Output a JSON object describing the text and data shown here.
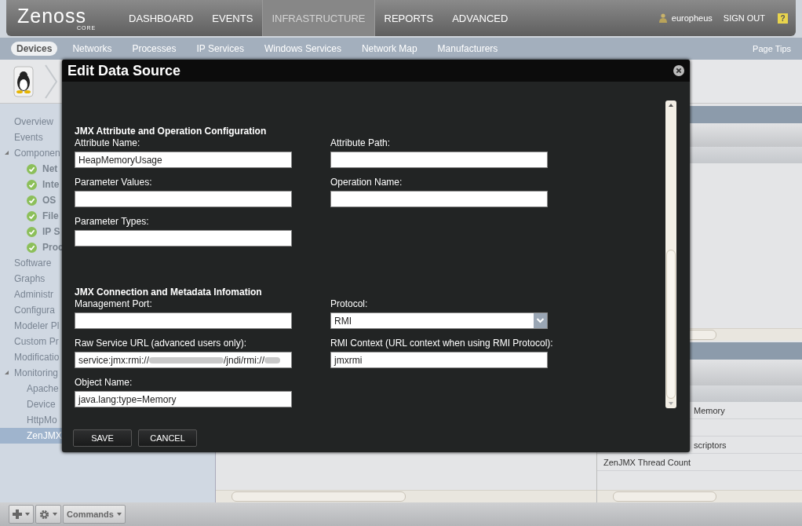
{
  "top_nav": {
    "logo": "Zenoss",
    "logo_sub": "CORE",
    "items": [
      {
        "label": "DASHBOARD",
        "selected": false
      },
      {
        "label": "EVENTS",
        "selected": false
      },
      {
        "label": "INFRASTRUCTURE",
        "selected": true
      },
      {
        "label": "REPORTS",
        "selected": false
      },
      {
        "label": "ADVANCED",
        "selected": false
      }
    ],
    "user": "europheus",
    "sign_out": "SIGN OUT",
    "help": "?"
  },
  "sub_nav": {
    "items": [
      {
        "label": "Devices",
        "selected": true
      },
      {
        "label": "Networks",
        "selected": false
      },
      {
        "label": "Processes",
        "selected": false
      },
      {
        "label": "IP Services",
        "selected": false
      },
      {
        "label": "Windows Services",
        "selected": false
      },
      {
        "label": "Network Map",
        "selected": false
      },
      {
        "label": "Manufacturers",
        "selected": false
      }
    ],
    "page_tips": "Page Tips"
  },
  "sidebar": {
    "items": [
      {
        "label": "Overview",
        "kind": "link",
        "selected": false
      },
      {
        "label": "Events",
        "kind": "link",
        "selected": false
      },
      {
        "label": "Componen",
        "kind": "group",
        "expanded": true,
        "selected": false,
        "children": [
          {
            "label": "Net",
            "kind": "status",
            "selected": false
          },
          {
            "label": "Inte",
            "kind": "status",
            "selected": false
          },
          {
            "label": "OS",
            "kind": "status",
            "selected": false
          },
          {
            "label": "File",
            "kind": "status",
            "selected": false
          },
          {
            "label": "IP S",
            "kind": "status",
            "selected": false
          },
          {
            "label": "Proc",
            "kind": "status",
            "selected": false
          }
        ]
      },
      {
        "label": "Software",
        "kind": "link",
        "selected": false
      },
      {
        "label": "Graphs",
        "kind": "link",
        "selected": false
      },
      {
        "label": "Administr",
        "kind": "link",
        "selected": false
      },
      {
        "label": "Configura",
        "kind": "link",
        "selected": false
      },
      {
        "label": "Modeler Pl",
        "kind": "link",
        "selected": false
      },
      {
        "label": "Custom Pr",
        "kind": "link",
        "selected": false
      },
      {
        "label": "Modificatio",
        "kind": "link",
        "selected": false
      },
      {
        "label": "Monitoring",
        "kind": "group",
        "expanded": true,
        "selected": false,
        "children": [
          {
            "label": "Apache",
            "kind": "link",
            "selected": false
          },
          {
            "label": "Device",
            "kind": "link",
            "selected": false
          },
          {
            "label": "HttpMo",
            "kind": "link",
            "selected": false
          },
          {
            "label": "ZenJMX",
            "kind": "link",
            "selected": true
          }
        ]
      }
    ]
  },
  "graph_rows": [
    {
      "text": "Memory"
    },
    {},
    {
      "text": "scriptors"
    },
    {
      "text": "ZenJMX Thread Count"
    }
  ],
  "dialog": {
    "title": "Edit Data Source",
    "sections": [
      {
        "heading": "JMX Attribute and Operation Configuration",
        "fields": [
          {
            "label": "Attribute Name:",
            "kind": "text",
            "value": "HeapMemoryUsage"
          },
          {
            "label": "Attribute Path:",
            "kind": "text"
          },
          {
            "label": "Parameter Values:",
            "kind": "text"
          },
          {
            "label": "Operation Name:",
            "kind": "text"
          },
          {
            "label": "Parameter Types:",
            "kind": "text"
          }
        ]
      },
      {
        "heading": "JMX Connection and Metadata Infomation",
        "fields": [
          {
            "label": "Management Port:",
            "kind": "text"
          },
          {
            "label": "Protocol:",
            "kind": "select",
            "value": "RMI"
          },
          {
            "label": "Raw Service URL (advanced users only):",
            "kind": "redacted",
            "value_parts": [
              "service:jmx:rmi://",
              "/jndi/rmi://"
            ]
          },
          {
            "label": "RMI Context (URL context when using RMI Protocol):",
            "kind": "text",
            "value": "jmxrmi"
          },
          {
            "label": "Object Name:",
            "kind": "text",
            "value": "java.lang:type=Memory"
          }
        ]
      }
    ],
    "buttons": [
      "SAVE",
      "CANCEL"
    ]
  },
  "bottom_toolbar": [
    {
      "kind": "add"
    },
    {
      "kind": "settings"
    },
    {
      "kind": "text",
      "label": "Commands"
    }
  ]
}
